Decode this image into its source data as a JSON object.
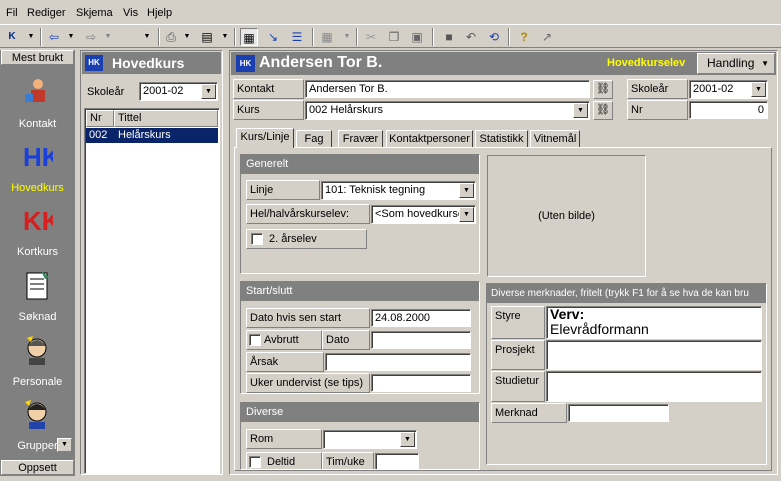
{
  "menu": [
    "Fil",
    "Rediger",
    "Skjema",
    "Vis",
    "Hjelp"
  ],
  "sidebar": {
    "top_label": "Mest brukt",
    "items": [
      "Kontakt",
      "Hovedkurs",
      "Kortkurs",
      "Søknad",
      "Personale",
      "Grupper"
    ],
    "active_item": "Hovedkurs",
    "bottom_label": "Oppsett"
  },
  "left_panel": {
    "title": "Hovedkurs",
    "skolear_label": "Skoleår",
    "skolear_value": "2001-02",
    "col_nr": "Nr",
    "col_tittel": "Tittel",
    "rows": [
      {
        "nr": "002",
        "tittel": "Helårskurs"
      }
    ]
  },
  "main": {
    "title": "Andersen Tor B.",
    "status": "Hovedkurselev",
    "handling_label": "Handling",
    "kontakt_label": "Kontakt",
    "kontakt_value": "Andersen Tor B.",
    "kurs_label": "Kurs",
    "kurs_value": "002 Helårskurs",
    "skolear_label": "Skoleår",
    "skolear_value": "2001-02",
    "nr_label": "Nr",
    "nr_value": "0"
  },
  "tabs": [
    "Kurs/Linje",
    "Fag",
    "Fravær",
    "Kontaktpersoner",
    "Statistikk",
    "Vitnemål"
  ],
  "generelt": {
    "title": "Generelt",
    "linje_label": "Linje",
    "linje_value": "101: Teknisk tegning",
    "hel_label": "Hel/halvårskurselev:",
    "hel_value": "<Som hovedkurset>",
    "arselev_label": "2. årselev"
  },
  "photo": {
    "text": "(Uten bilde)"
  },
  "start": {
    "title": "Start/slutt",
    "dato_label": "Dato hvis sen start",
    "dato_value": "24.08.2000",
    "avbrutt_label": "Avbrutt",
    "dato2_label": "Dato",
    "arsak_label": "Årsak",
    "uker_label": "Uker undervist (se tips)"
  },
  "diverse": {
    "title": "Diverse",
    "rom_label": "Rom",
    "deltid_label": "Deltid",
    "tim_label": "Tim/uke"
  },
  "merknader": {
    "title": "Diverse merknader, fritelt (trykk F1 for å se hva de kan bru",
    "styre_label": "Styre",
    "styre_text": "Verv:",
    "styre_text2": "Elevrådformann",
    "prosjekt_label": "Prosjekt",
    "studietur_label": "Studietur",
    "merknad_label": "Merknad"
  }
}
